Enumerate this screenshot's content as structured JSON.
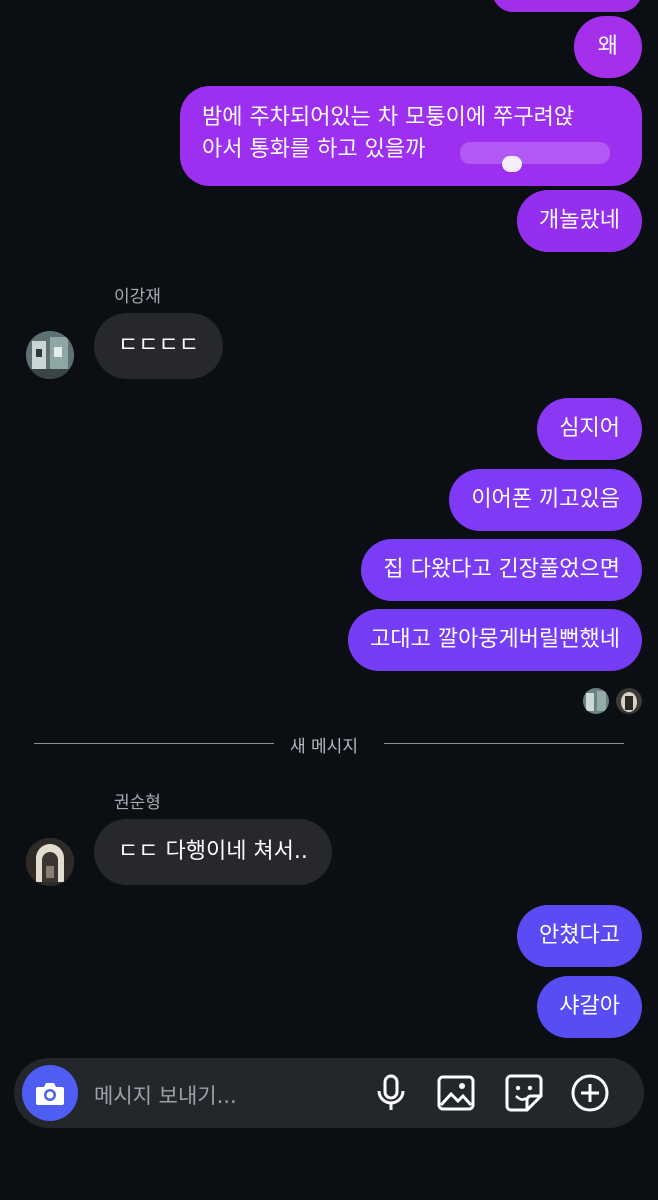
{
  "messages_top": {
    "out_1": "왜",
    "out_2_line1": "밤에 주차되어있는 차 모퉁이에 쭈구려앉",
    "out_2_line2": "아서 통화를 하고 있을까",
    "out_3": "개놀랐네"
  },
  "thread_1": {
    "sender": "이강재",
    "message": "ㄷㄷㄷㄷ"
  },
  "messages_mid": {
    "out_1": "심지어",
    "out_2": "이어폰 끼고있음",
    "out_3": "집 다왔다고 긴장풀었으면",
    "out_4": "고대고 깔아뭉게버릴뻔했네"
  },
  "divider": {
    "label": "새 메시지"
  },
  "thread_2": {
    "sender": "권순형",
    "message": "ㄷㄷ 다행이네 쳐서.."
  },
  "messages_bottom": {
    "out_1": "안쳤다고",
    "out_2": "샤갈아"
  },
  "composer": {
    "placeholder": "메시지 보내기..."
  },
  "icons": {
    "camera": "camera-icon",
    "mic": "microphone-icon",
    "gallery": "image-icon",
    "sticker": "sticker-icon",
    "plus": "plus-circle-icon"
  },
  "colors": {
    "background": "#0b0e13",
    "bubble_in": "#26282d",
    "bubble_out_purple": "#9a2ff0",
    "bubble_out_violet": "#7a3ef5",
    "bubble_out_blue": "#5a4cf5",
    "camera_button": "#4e5ef2"
  }
}
